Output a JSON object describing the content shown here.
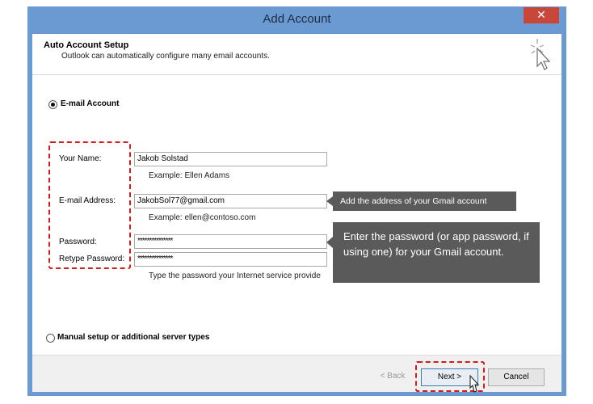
{
  "window": {
    "title": "Add Account",
    "close_glyph": "✕"
  },
  "header": {
    "title": "Auto Account Setup",
    "subtitle": "Outlook can automatically configure many email accounts.",
    "icon": "magic-wand-cursor-icon"
  },
  "email_account": {
    "option_label": "E-mail Account",
    "selected": true,
    "your_name": {
      "label": "Your Name:",
      "value": "Jakob Solstad",
      "example": "Example: Ellen Adams"
    },
    "email": {
      "label": "E-mail Address:",
      "value": "JakobSol77@gmail.com",
      "example": "Example: ellen@contoso.com"
    },
    "password": {
      "label": "Password:",
      "value": "***************"
    },
    "retype_password": {
      "label": "Retype Password:",
      "value": "***************"
    },
    "password_hint": "Type the password your Internet service provide"
  },
  "callouts": {
    "email": "Add the address of your Gmail account",
    "password": "Enter the password (or app password, if using one) for your Gmail account."
  },
  "manual_setup": {
    "option_label": "Manual setup or additional server types",
    "selected": false
  },
  "footer": {
    "back_label": "< Back",
    "next_label": "Next >",
    "cancel_label": "Cancel"
  },
  "colors": {
    "titlebar": "#6b9ad2",
    "close": "#c7473a",
    "highlight": "#d01c1c",
    "callout": "#5a5a5a"
  }
}
